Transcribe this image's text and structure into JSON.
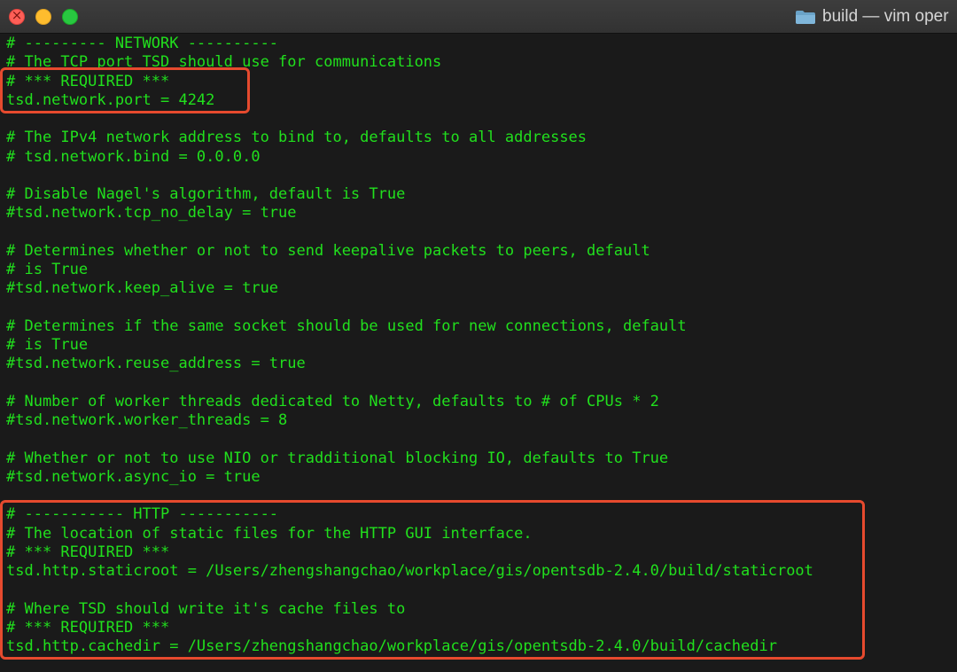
{
  "window": {
    "title": "build — vim oper",
    "traffic_lights": [
      "close",
      "minimize",
      "maximize"
    ],
    "colors": {
      "text": "#21e01d",
      "background": "#1a1a1a",
      "highlight": "#e64a2e"
    },
    "folder_icon": "folder-icon"
  },
  "lines": [
    "# --------- NETWORK ----------",
    "# The TCP port TSD should use for communications",
    "# *** REQUIRED ***",
    "tsd.network.port = 4242",
    "",
    "# The IPv4 network address to bind to, defaults to all addresses",
    "# tsd.network.bind = 0.0.0.0",
    "",
    "# Disable Nagel's algorithm, default is True",
    "#tsd.network.tcp_no_delay = true",
    "",
    "# Determines whether or not to send keepalive packets to peers, default",
    "# is True",
    "#tsd.network.keep_alive = true",
    "",
    "# Determines if the same socket should be used for new connections, default",
    "# is True",
    "#tsd.network.reuse_address = true",
    "",
    "# Number of worker threads dedicated to Netty, defaults to # of CPUs * 2",
    "#tsd.network.worker_threads = 8",
    "",
    "# Whether or not to use NIO or tradditional blocking IO, defaults to True",
    "#tsd.network.async_io = true",
    "",
    "# ----------- HTTP -----------",
    "# The location of static files for the HTTP GUI interface.",
    "# *** REQUIRED ***",
    "tsd.http.staticroot = /Users/zhengshangchao/workplace/gis/opentsdb-2.4.0/build/staticroot",
    "",
    "# Where TSD should write it's cache files to",
    "# *** REQUIRED ***",
    "tsd.http.cachedir = /Users/zhengshangchao/workplace/gis/opentsdb-2.4.0/build/cachedir"
  ],
  "highlights": [
    {
      "name": "required-network-port-highlight",
      "from_line": 2,
      "to_line": 3
    },
    {
      "name": "http-section-highlight",
      "from_line": 25,
      "to_line": 32
    }
  ]
}
